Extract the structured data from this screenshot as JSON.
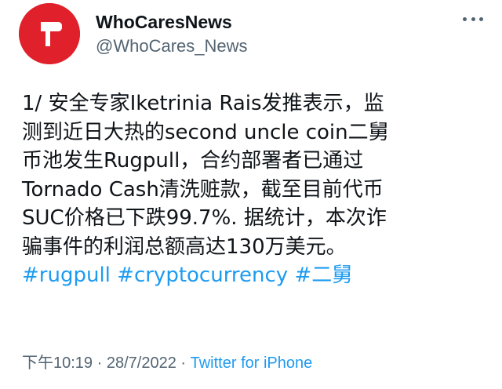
{
  "author": {
    "display_name": "WhoCaresNews",
    "handle": "@WhoCares_News"
  },
  "icons": {
    "avatar": "red-circle-logo-icon",
    "more": "more-options-icon"
  },
  "tweet": {
    "lines": [
      "1/ 安全专家Iketrinia Rais发推表示，监",
      "测到近日大热的second uncle coin二舅",
      "币池发生Rugpull，合约部署者已通过",
      "Tornado Cash清洗赃款，截至目前代币",
      "SUC价格已下跌99.7%. 据统计，本次诈",
      "骗事件的利润总额高达130万美元。"
    ],
    "hashtags": [
      "#rugpull",
      "#cryptocurrency",
      "#二舅"
    ]
  },
  "meta": {
    "time": "下午10:19",
    "separator1": " · ",
    "date": "28/7/2022",
    "separator2": " · ",
    "source": "Twitter for iPhone"
  },
  "colors": {
    "avatar_bg": "#e0202a",
    "link": "#1d9bf0",
    "secondary_text": "#536471",
    "primary_text": "#0f1419"
  }
}
